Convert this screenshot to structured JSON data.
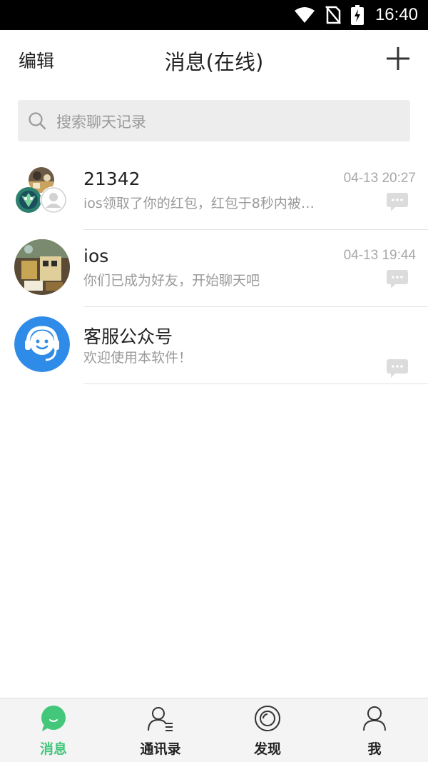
{
  "status_bar": {
    "time": "16:40"
  },
  "header": {
    "edit_label": "编辑",
    "title": "消息(在线)"
  },
  "search": {
    "placeholder": "搜索聊天记录"
  },
  "chats": [
    {
      "name": "21342",
      "preview": "ios领取了你的红包，红包于8秒内被…",
      "time": "04-13 20:27",
      "avatar": "group-avatar"
    },
    {
      "name": "ios",
      "preview": "你们已成为好友，开始聊天吧",
      "time": "04-13 19:44",
      "avatar": "photo-avatar"
    },
    {
      "name": "客服公众号",
      "preview": "欢迎使用本软件！",
      "time": "",
      "avatar": "customer-service-avatar"
    }
  ],
  "tabs": [
    {
      "label": "消息",
      "icon": "chat-bubble-icon",
      "active": true
    },
    {
      "label": "通讯录",
      "icon": "contacts-icon",
      "active": false
    },
    {
      "label": "发现",
      "icon": "discover-icon",
      "active": false
    },
    {
      "label": "我",
      "icon": "profile-icon",
      "active": false
    }
  ],
  "colors": {
    "accent": "#43c77b",
    "cs_blue": "#2f8be8",
    "search_bg": "#ededed"
  }
}
